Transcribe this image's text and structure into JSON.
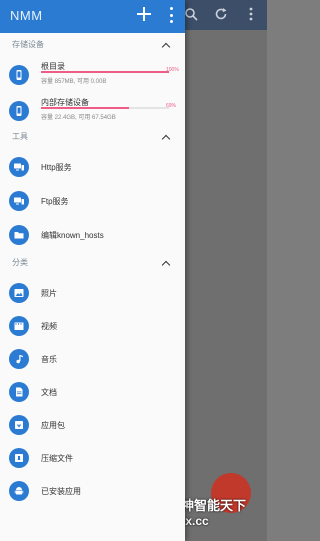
{
  "colors": {
    "accent": "#2b7bd3",
    "usage_bar": "#ee5d86",
    "background": "#fafafa"
  },
  "drawer": {
    "title": "NMM",
    "add_icon": "plus-icon",
    "more_icon": "more-vert-icon"
  },
  "storage_section": {
    "label": "存储设备",
    "items": [
      {
        "name": "根目录",
        "usage_percent": 100,
        "usage_label": "100%",
        "detail": "容量 857MB, 可用 0.00B",
        "icon": "phone-icon"
      },
      {
        "name": "内部存储设备",
        "usage_percent": 69,
        "usage_label": "69%",
        "detail": "容量 22.4GB, 可用 67.54GB",
        "icon": "phone-icon"
      }
    ]
  },
  "tools_section": {
    "label": "工具",
    "items": [
      {
        "label": "Http服务",
        "icon": "http-server-icon"
      },
      {
        "label": "Ftp服务",
        "icon": "ftp-server-icon"
      },
      {
        "label": "编辑known_hosts",
        "icon": "folder-icon"
      }
    ]
  },
  "categories_section": {
    "label": "分类",
    "items": [
      {
        "label": "照片",
        "icon": "image-icon"
      },
      {
        "label": "视频",
        "icon": "movie-icon"
      },
      {
        "label": "音乐",
        "icon": "music-note-icon"
      },
      {
        "label": "文档",
        "icon": "document-icon"
      },
      {
        "label": "应用包",
        "icon": "package-icon"
      },
      {
        "label": "压缩文件",
        "icon": "archive-icon"
      },
      {
        "label": "已安装应用",
        "icon": "android-icon"
      }
    ]
  },
  "watermark": {
    "line1": "八神智能天下",
    "line2": "zntx.cc"
  }
}
